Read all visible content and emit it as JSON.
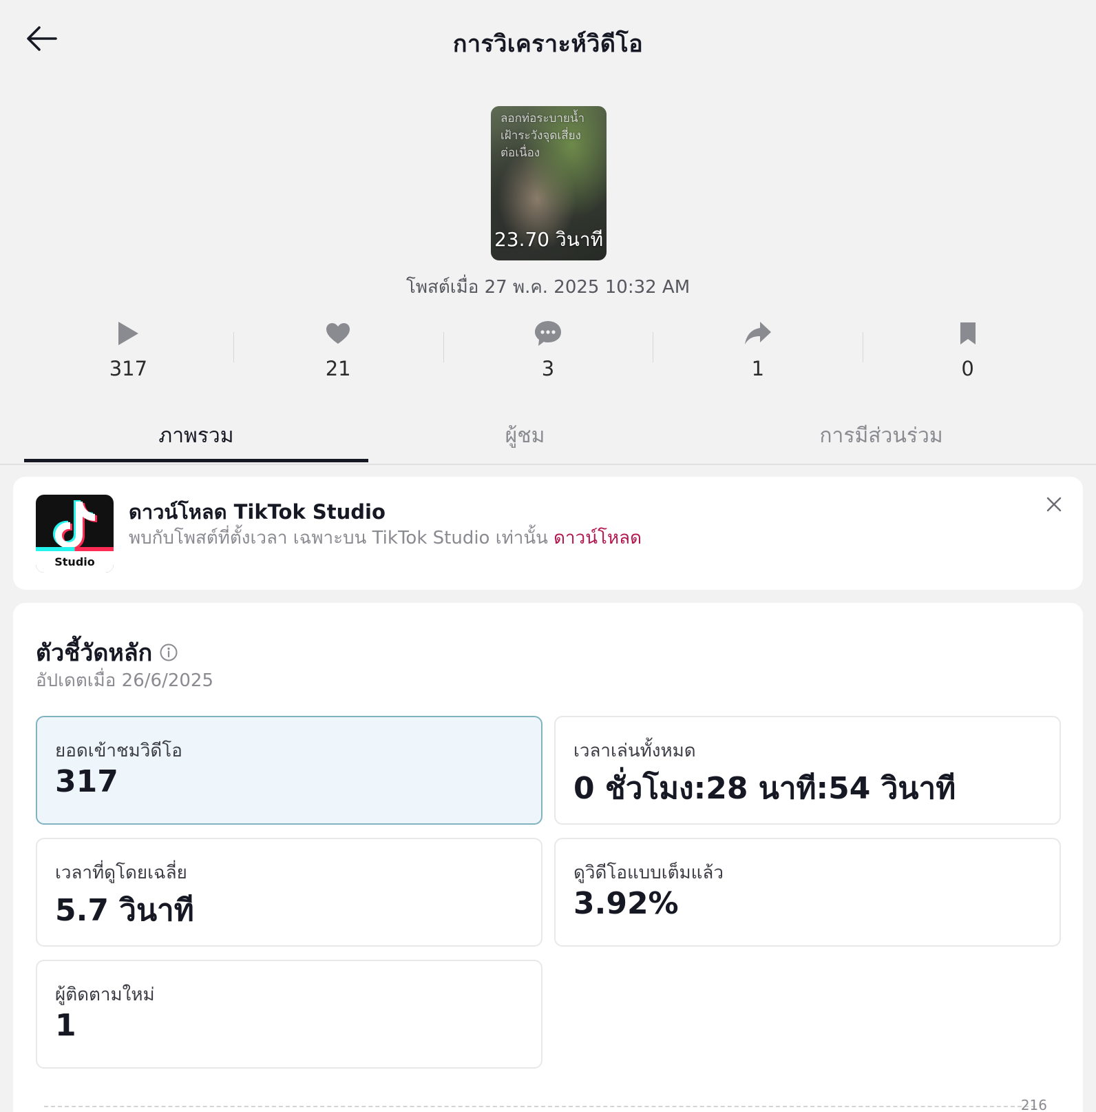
{
  "header": {
    "title": "การวิเคราะห์วิดีโอ",
    "back_icon": "arrow-left-icon"
  },
  "video": {
    "thumbnail_caption": [
      "ลอกท่อระบายน้ำ",
      "เฝ้าระวังจุดเสี่ยง",
      "ต่อเนื่อง"
    ],
    "duration": "23.70 วินาที",
    "posted": "โพสต์เมื่อ 27 พ.ค. 2025 10:32 AM"
  },
  "stats": [
    {
      "icon": "play-icon",
      "value": "317"
    },
    {
      "icon": "heart-icon",
      "value": "21"
    },
    {
      "icon": "comment-icon",
      "value": "3"
    },
    {
      "icon": "share-icon",
      "value": "1"
    },
    {
      "icon": "bookmark-icon",
      "value": "0"
    }
  ],
  "tabs": [
    {
      "label": "ภาพรวม",
      "active": true
    },
    {
      "label": "ผู้ชม",
      "active": false
    },
    {
      "label": "การมีส่วนร่วม",
      "active": false
    }
  ],
  "banner": {
    "app_label": "Studio",
    "title": "ดาวน์โหลด TikTok Studio",
    "subtitle": "พบกับโพสต์ที่ตั้งเวลา เฉพาะบน TikTok Studio เท่านั้น",
    "link": "ดาวน์โหลด",
    "link_color": "#b3174f"
  },
  "metrics": {
    "title": "ตัวชี้วัดหลัก",
    "updated": "อัปเดตเมื่อ 26/6/2025",
    "items": [
      {
        "label": "ยอดเข้าชมวิดีโอ",
        "value": "317",
        "selected": true
      },
      {
        "label": "เวลาเล่นทั้งหมด",
        "value": "0 ชั่วโมง:28 นาที:54 วินาที",
        "selected": false
      },
      {
        "label": "เวลาที่ดูโดยเฉลี่ย",
        "value": "5.7 วินาที",
        "selected": false
      },
      {
        "label": "ดูวิดีโอแบบเต็มแล้ว",
        "value": "3.92%",
        "selected": false
      },
      {
        "label": "ผู้ติดตามใหม่",
        "value": "1",
        "selected": false
      }
    ],
    "chart_axis_label": "216"
  },
  "colors": {
    "background": "#f2f2f2",
    "text_primary": "#161823",
    "text_secondary": "#8a8b91",
    "selected_metric_bg": "#eef6fb",
    "selected_metric_border": "#7fb3bf"
  }
}
